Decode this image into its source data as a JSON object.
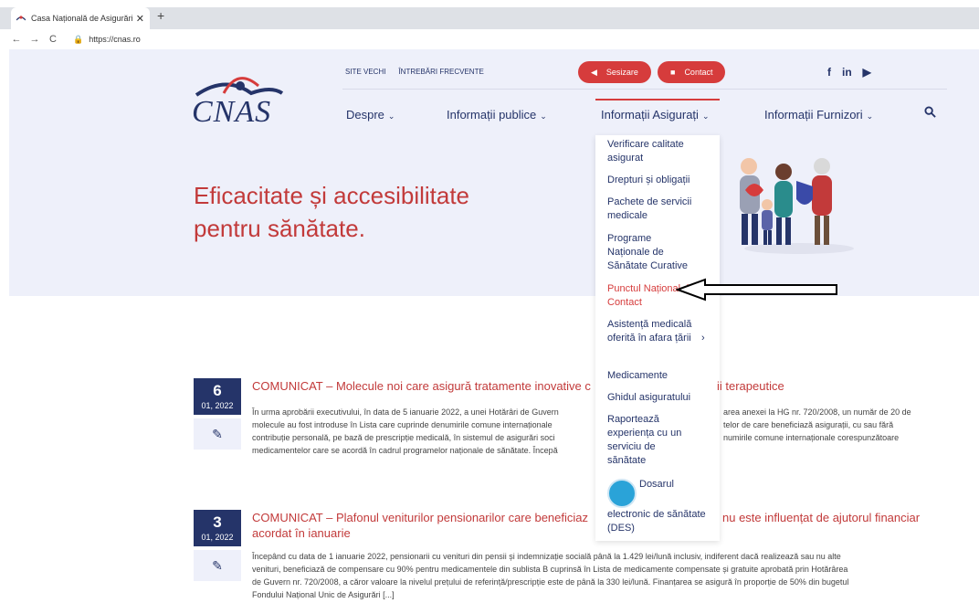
{
  "browser": {
    "tab_title": "Casa Națională de Asigurări de S",
    "tab_close": "✕",
    "new_tab": "+",
    "url": "https://cnas.ro",
    "back": "←",
    "forward": "→",
    "reload": "C"
  },
  "header": {
    "logo_text": "CNAS",
    "top_links": [
      "SITE VECHI",
      "ÎNTREBĂRI FRECVENTE"
    ],
    "sesizare_label": "Sesizare",
    "contact_label": "Contact",
    "social": [
      "f",
      "in",
      "▶"
    ],
    "nav": [
      "Despre",
      "Informații publice",
      "Informații Asigurați",
      "Informații Furnizori"
    ],
    "chevron": "⌄",
    "search_icon": "🔍"
  },
  "hero": {
    "line1": "Eficacitate și accesibilitate",
    "line2": "pentru sănătate."
  },
  "dropdown": {
    "items": [
      "Verificare calitate asigurat",
      "Drepturi și obligații",
      "Pachete de servicii medicale",
      "Programe Naționale de Sănătate Curative",
      "Punctul Național de Contact",
      "Asistență medicală oferită în afara țării",
      "Medicamente",
      "Ghidul asiguratului",
      "Raportează experiența cu un serviciu de sănătate",
      "Dosarul",
      "electronic de sănătate (DES)"
    ],
    "submenu_arrow": "›"
  },
  "posts": [
    {
      "day": "6",
      "month": "01, 2022",
      "title": "COMUNICAT – Molecule noi care asigură tratamente inovative c",
      "title_end": "ii terapeutice",
      "excerpt": [
        "În urma aprobării executivului, în data de 5 ianuarie 2022, a unei Hotărâri de Guvern",
        "area anexei la HG nr. 720/2008, un număr de 20 de",
        "molecule au fost introduse în Lista care cuprinde denumirile comune internaționale",
        "telor de care beneficiază asigurații, cu sau fără",
        "contribuție personală, pe bază de prescripție medicală, în sistemul de asigurări soci",
        "numirile comune internaționale corespunzătoare",
        "medicamentelor care se acordă în cadrul programelor naționale de sănătate. Începă"
      ]
    },
    {
      "day": "3",
      "month": "01, 2022",
      "title": "COMUNICAT – Plafonul veniturilor pensionarilor care beneficiaz",
      "title_end": "nu este influențat de ajutorul financiar",
      "title_line2": "acordat în ianuarie",
      "excerpt": [
        "Începând cu data de 1 ianuarie 2022, pensionarii cu venituri din pensii și indemnizație socială până la 1.429 lei/lună inclusiv, indiferent dacă realizează sau nu alte",
        "venituri, beneficiază de compensare cu 90% pentru medicamentele din sublista B cuprinsă în Lista de medicamente compensate și gratuite aprobată prin Hotărârea",
        "de Guvern nr. 720/2008, a căror valoare  la nivelul prețului de referință/prescripție este de până la 330 lei/lună. Finanțarea se asigură în proporție de 50% din bugetul",
        "Fondului Național Unic de Asigurări [...]"
      ]
    }
  ],
  "colors": {
    "brand_navy": "#253469",
    "brand_red": "#d63c3c",
    "band": "#eef0fa"
  }
}
